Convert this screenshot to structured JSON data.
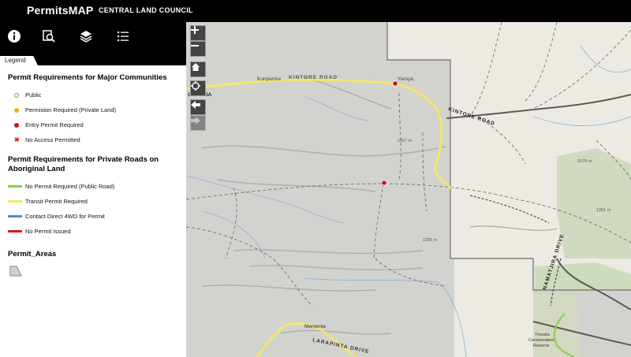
{
  "header": {
    "title": "PermitsMAP",
    "org": "CENTRAL LAND COUNCIL"
  },
  "toolbar": {
    "icons": [
      "info-icon",
      "search-map-icon",
      "layers-icon",
      "list-icon"
    ]
  },
  "panel": {
    "tab_label": "Legend"
  },
  "legend": {
    "communities": {
      "title": "Permit Requirements for Major Communities",
      "items": [
        {
          "label": "Public",
          "color": "#4caf50",
          "shape": "ring"
        },
        {
          "label": "Permision Required (Private Land)",
          "color": "#e6b422",
          "shape": "dot"
        },
        {
          "label": "Entry Permit Required",
          "color": "#c0161d",
          "shape": "dot"
        },
        {
          "label": "No Access Permitted",
          "color": "#d62828",
          "shape": "x"
        }
      ]
    },
    "roads": {
      "title": "Permit Requirements for Private Roads on Aboriginal Land",
      "items": [
        {
          "label": "No Permit Required (Public Road)",
          "color": "#8bd14a"
        },
        {
          "label": "Transit Permit Required",
          "color": "#f3e56b"
        },
        {
          "label": "Contact Direct 4WD for Permit",
          "color": "#4a90c8"
        },
        {
          "label": "No Permit Issued",
          "color": "#e0161c"
        }
      ]
    },
    "areas": {
      "title": "Permit_Areas"
    }
  },
  "map": {
    "places": {
      "kunparrka": "Kunparrka",
      "yaruya": "Yaruya",
      "kintore_left": "KINTORE ROAD",
      "kintore_right": "KINTORE ROAD",
      "namatjira": "NAMATJIRA DRIVE",
      "mereenie": "Mereenie",
      "larapinta": "LARAPINTA DRIVE",
      "tnorala": "Tnorala",
      "conservation": "Conservation",
      "reserve": "Reserve",
      "one_road": "ONE ROA",
      "elev_1": "1507 m",
      "elev_2": "1578 m",
      "elev_3": "1261 m",
      "elev_4": "1209 m"
    }
  }
}
